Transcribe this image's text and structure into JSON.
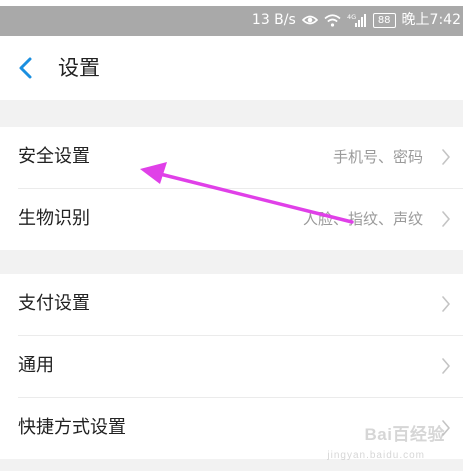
{
  "status_bar": {
    "net_speed": "13 B/s",
    "signal_label": "4G",
    "battery": "88",
    "time": "晚上7:42"
  },
  "header": {
    "title": "设置"
  },
  "settings": {
    "group1": [
      {
        "label": "安全设置",
        "value": "手机号、密码"
      },
      {
        "label": "生物识别",
        "value": "人脸、指纹、声纹"
      }
    ],
    "group2": [
      {
        "label": "支付设置",
        "value": ""
      },
      {
        "label": "通用",
        "value": ""
      },
      {
        "label": "快捷方式设置",
        "value": ""
      }
    ]
  },
  "watermark": {
    "text": "Bai百经验",
    "sub": "jingyan.baidu.com"
  },
  "colors": {
    "accent": "#1a8fe0",
    "annotation": "#e040e8",
    "status_bar": "#a9a9a9"
  },
  "icons": {
    "back": "chevron-left-icon",
    "row": "chevron-right-icon",
    "wifi": "wifi-icon",
    "signal": "signal-icon",
    "eye": "eye-icon"
  }
}
